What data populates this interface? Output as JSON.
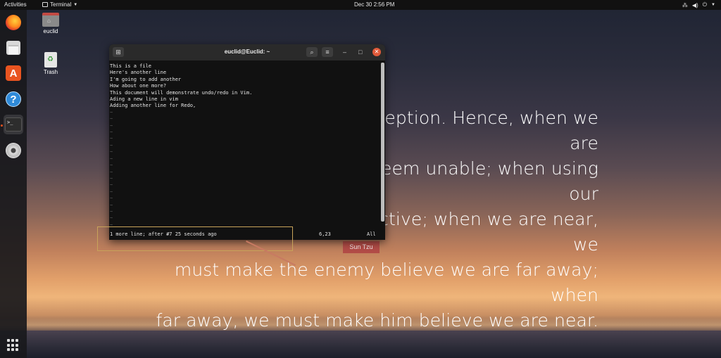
{
  "topbar": {
    "activities": "Activities",
    "app_menu": "Terminal",
    "clock": "Dec 30  2:56 PM",
    "tray_icons": [
      "network-icon",
      "volume-icon",
      "power-icon"
    ]
  },
  "dock": {
    "items": [
      {
        "name": "firefox",
        "icon": "firefox-icon"
      },
      {
        "name": "files",
        "icon": "files-icon"
      },
      {
        "name": "ubuntu-software",
        "icon": "ubuntu-software-icon",
        "glyph": "A"
      },
      {
        "name": "help",
        "icon": "help-icon",
        "glyph": "?"
      },
      {
        "name": "terminal",
        "icon": "terminal-icon",
        "glyph": ">_",
        "active": true
      },
      {
        "name": "dvd",
        "icon": "dvd-icon"
      }
    ],
    "show_apps": "show-applications-icon"
  },
  "desktop": {
    "home_label": "euclid",
    "trash_label": "Trash"
  },
  "quote": {
    "lines": [
      "All warfare is based on deception. Hence, when we are",
      "able to attack, we must seem unable; when using our",
      "forces, we must appear inactive; when we are near, we",
      "must make the enemy believe we are far away; when",
      "far away, we must make him believe we are near."
    ],
    "author": "Sun Tzu"
  },
  "terminal": {
    "title": "euclid@Euclid: ~",
    "lines": [
      "This is a file",
      "Here's another line",
      "I'm going to add another",
      "How about one more?",
      "This document will demonstrate undo/redo in Vim.",
      "Ading a new line in vim",
      "Adding another line for Redo,"
    ],
    "tilde": "~",
    "status_message": "1 more line; after #7  25 seconds ago",
    "status_position": "6,23",
    "status_scroll": "All",
    "colors": {
      "background": "#111111",
      "header": "#2a2a2a",
      "close": "#e05a3a"
    }
  }
}
